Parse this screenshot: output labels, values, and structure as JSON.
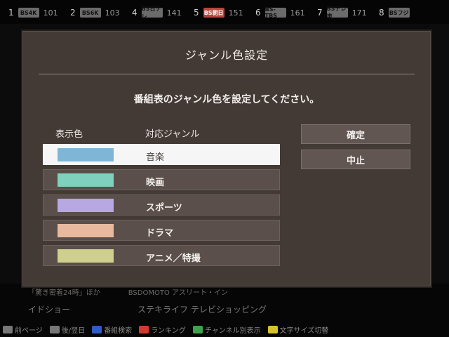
{
  "epg": {
    "channels": [
      {
        "num": "1",
        "logo": "BS4K",
        "code": "101",
        "red": false
      },
      {
        "num": "2",
        "logo": "BS6K",
        "code": "103",
        "red": false
      },
      {
        "num": "4",
        "logo": "BS日テレ",
        "code": "141",
        "red": false
      },
      {
        "num": "5",
        "logo": "BS朝日",
        "code": "151",
        "red": true
      },
      {
        "num": "6",
        "logo": "BS-TBS",
        "code": "161",
        "red": false
      },
      {
        "num": "7",
        "logo": "BSテレ東",
        "code": "171",
        "red": false
      },
      {
        "num": "8",
        "logo": "BSフジ",
        "code": "",
        "red": false
      }
    ],
    "line1": "「驚き密着24時」ほか　　　　BSDOMOTO  アスリート・イン",
    "line2": "イドショー　　　　　　　　ステキライフ テレビショッピング",
    "footer": [
      {
        "key": "",
        "label": "前ページ"
      },
      {
        "key": "",
        "label": "後/翌日"
      },
      {
        "key": "blue",
        "label": "番組検索"
      },
      {
        "key": "red",
        "label": "ランキング"
      },
      {
        "key": "green",
        "label": "チャンネル別表示"
      },
      {
        "key": "yellow",
        "label": "文字サイズ切替"
      }
    ]
  },
  "dialog": {
    "title": "ジャンル色設定",
    "message": "番組表のジャンル色を設定してください。",
    "col_color": "表示色",
    "col_genre": "対応ジャンル",
    "rows": [
      {
        "label": "音楽",
        "color": "#7fb6d6",
        "selected": true
      },
      {
        "label": "映画",
        "color": "#7fd1bd",
        "selected": false
      },
      {
        "label": "スポーツ",
        "color": "#b7a8e3",
        "selected": false
      },
      {
        "label": "ドラマ",
        "color": "#e8b99e",
        "selected": false
      },
      {
        "label": "アニメ／特撮",
        "color": "#d0d08e",
        "selected": false
      }
    ],
    "ok_label": "確定",
    "cancel_label": "中止"
  }
}
